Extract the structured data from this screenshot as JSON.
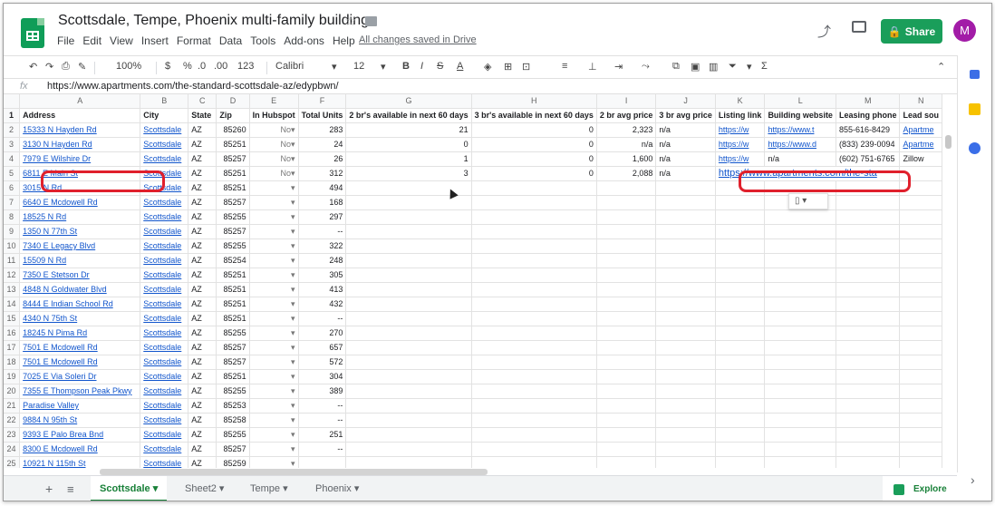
{
  "doc": {
    "title": "Scottsdale, Tempe, Phoenix multi-family buildings",
    "saved": "All changes saved in Drive"
  },
  "menu": [
    "File",
    "Edit",
    "View",
    "Insert",
    "Format",
    "Data",
    "Tools",
    "Add-ons",
    "Help"
  ],
  "share": "Share",
  "avatar": "M",
  "toolbar": {
    "zoom": "100%",
    "currency": "$",
    "percent": "%",
    "dec_less": ".0",
    "dec_more": ".00",
    "fmt": "123",
    "font": "Calibri",
    "size": "12"
  },
  "formula": {
    "fx": "fx",
    "value": "https://www.apartments.com/the-standard-scottsdale-az/edypbwn/"
  },
  "cols": [
    "A",
    "B",
    "C",
    "D",
    "E",
    "F",
    "G",
    "H",
    "I",
    "J",
    "K",
    "L",
    "M",
    "N"
  ],
  "headers": [
    "Address",
    "City",
    "State",
    "Zip",
    "In Hubspot",
    "Total Units",
    "2 br's available in next 60 days",
    "3 br's available in next 60 days",
    "2 br avg price",
    "3 br avg price",
    "Listing link",
    "Building website",
    "Leasing phone",
    "Lead sou"
  ],
  "rows": [
    [
      "15333 N Hayden Rd",
      "Scottsdale",
      "AZ",
      "85260",
      "No",
      "283",
      "21",
      "0",
      "2,323",
      "n/a",
      "https://w",
      "https://www.t",
      "855-616-8429",
      "Apartme"
    ],
    [
      "3130 N Hayden Rd",
      "Scottsdale",
      "AZ",
      "85251",
      "No",
      "24",
      "0",
      "0",
      "n/a",
      "n/a",
      "https://w",
      "https://www.d",
      "(833) 239-0094",
      "Apartme"
    ],
    [
      "7979 E Wilshire Dr",
      "Scottsdale",
      "AZ",
      "85257",
      "No",
      "26",
      "1",
      "0",
      "1,600",
      "n/a",
      "https://w",
      "n/a",
      "(602) 751-6765",
      "Zillow"
    ],
    [
      "6811 E Main St",
      "Scottsdale",
      "AZ",
      "85251",
      "No",
      "312",
      "3",
      "0",
      "2,088",
      "n/a",
      "https://www.apartments.com/the-sta",
      "",
      "",
      ""
    ],
    [
      "3015 N Rd",
      "Scottsdale",
      "AZ",
      "85251",
      "",
      "494",
      "",
      "",
      "",
      "",
      "",
      "",
      "",
      ""
    ],
    [
      "6640 E Mcdowell Rd",
      "Scottsdale",
      "AZ",
      "85257",
      "",
      "168",
      "",
      "",
      "",
      "",
      "",
      "",
      "",
      ""
    ],
    [
      "18525 N Rd",
      "Scottsdale",
      "AZ",
      "85255",
      "",
      "297",
      "",
      "",
      "",
      "",
      "",
      "",
      "",
      ""
    ],
    [
      "1350 N 77th St",
      "Scottsdale",
      "AZ",
      "85257",
      "",
      "--",
      "",
      "",
      "",
      "",
      "",
      "",
      "",
      ""
    ],
    [
      "7340 E Legacy Blvd",
      "Scottsdale",
      "AZ",
      "85255",
      "",
      "322",
      "",
      "",
      "",
      "",
      "",
      "",
      "",
      ""
    ],
    [
      "15509 N Rd",
      "Scottsdale",
      "AZ",
      "85254",
      "",
      "248",
      "",
      "",
      "",
      "",
      "",
      "",
      "",
      ""
    ],
    [
      "7350 E Stetson Dr",
      "Scottsdale",
      "AZ",
      "85251",
      "",
      "305",
      "",
      "",
      "",
      "",
      "",
      "",
      "",
      ""
    ],
    [
      "4848 N Goldwater Blvd",
      "Scottsdale",
      "AZ",
      "85251",
      "",
      "413",
      "",
      "",
      "",
      "",
      "",
      "",
      "",
      ""
    ],
    [
      "8444 E Indian School Rd",
      "Scottsdale",
      "AZ",
      "85251",
      "",
      "432",
      "",
      "",
      "",
      "",
      "",
      "",
      "",
      ""
    ],
    [
      "4340 N 75th St",
      "Scottsdale",
      "AZ",
      "85251",
      "",
      "--",
      "",
      "",
      "",
      "",
      "",
      "",
      "",
      ""
    ],
    [
      "18245 N Pima Rd",
      "Scottsdale",
      "AZ",
      "85255",
      "",
      "270",
      "",
      "",
      "",
      "",
      "",
      "",
      "",
      ""
    ],
    [
      "7501 E Mcdowell Rd",
      "Scottsdale",
      "AZ",
      "85257",
      "",
      "657",
      "",
      "",
      "",
      "",
      "",
      "",
      "",
      ""
    ],
    [
      "7501 E Mcdowell Rd",
      "Scottsdale",
      "AZ",
      "85257",
      "",
      "572",
      "",
      "",
      "",
      "",
      "",
      "",
      "",
      ""
    ],
    [
      "7025 E Via Soleri Dr",
      "Scottsdale",
      "AZ",
      "85251",
      "",
      "304",
      "",
      "",
      "",
      "",
      "",
      "",
      "",
      ""
    ],
    [
      "7355 E Thompson Peak Pkwy",
      "Scottsdale",
      "AZ",
      "85255",
      "",
      "389",
      "",
      "",
      "",
      "",
      "",
      "",
      "",
      ""
    ],
    [
      "Paradise Valley",
      "Scottsdale",
      "AZ",
      "85253",
      "",
      "--",
      "",
      "",
      "",
      "",
      "",
      "",
      "",
      ""
    ],
    [
      "9884 N 95th St",
      "Scottsdale",
      "AZ",
      "85258",
      "",
      "--",
      "",
      "",
      "",
      "",
      "",
      "",
      "",
      ""
    ],
    [
      "9393 E Palo Brea Bnd",
      "Scottsdale",
      "AZ",
      "85255",
      "",
      "251",
      "",
      "",
      "",
      "",
      "",
      "",
      "",
      ""
    ],
    [
      "8300 E Mcdowell Rd",
      "Scottsdale",
      "AZ",
      "85257",
      "",
      "--",
      "",
      "",
      "",
      "",
      "",
      "",
      "",
      ""
    ],
    [
      "10921 N 115th St",
      "Scottsdale",
      "AZ",
      "85259",
      "",
      "",
      "",
      "",
      "",
      "",
      "",
      "",
      "",
      ""
    ]
  ],
  "sheets": [
    "Scottsdale",
    "Sheet2",
    "Tempe",
    "Phoenix"
  ],
  "explore": "Explore"
}
